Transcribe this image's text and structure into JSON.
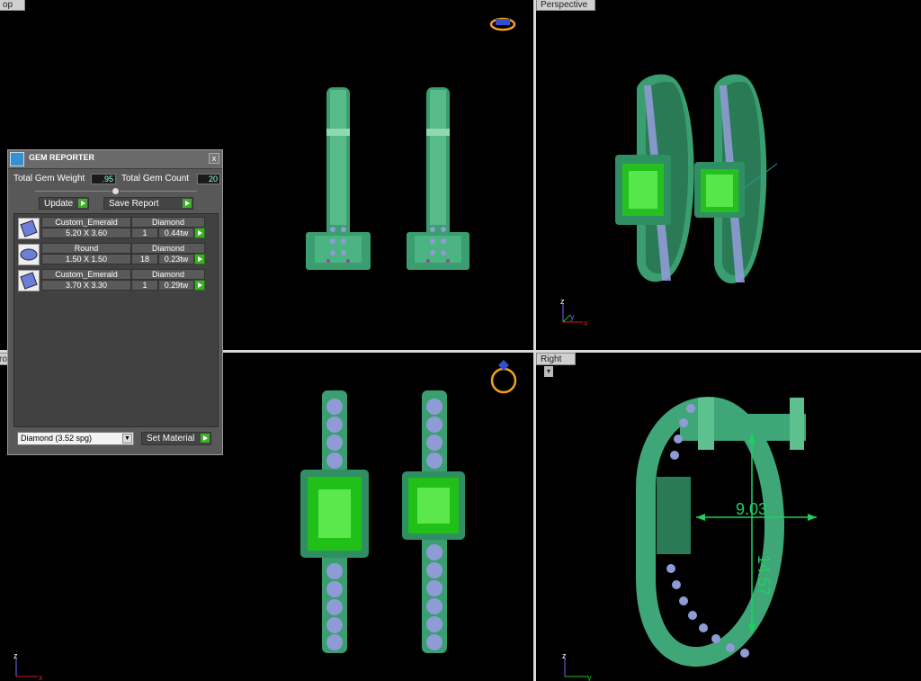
{
  "viewports": {
    "top_label": "op",
    "perspective_label": "Perspective",
    "right_label": "Right",
    "front_label": "ro"
  },
  "axes": {
    "z": "z",
    "y": "y",
    "x": "x"
  },
  "dimensions": {
    "width": "9.03",
    "height": "14.57"
  },
  "gem_reporter": {
    "title": "GEM REPORTER",
    "close": "x",
    "total_weight_label": "Total Gem Weight",
    "total_weight_value": ".95",
    "total_count_label": "Total Gem Count",
    "total_count_value": "20",
    "update_button": "Update",
    "save_report_button": "Save Report",
    "gems": [
      {
        "shape": "Custom_Emerald",
        "material": "Diamond",
        "size": "5.20 X 3.60",
        "count": "1",
        "weight": "0.44tw"
      },
      {
        "shape": "Round",
        "material": "Diamond",
        "size": "1.50 X 1.50",
        "count": "18",
        "weight": "0.23tw"
      },
      {
        "shape": "Custom_Emerald",
        "material": "Diamond",
        "size": "3.70 X 3.30",
        "count": "1",
        "weight": "0.29tw"
      }
    ],
    "material_select": "Diamond     (3.52 spg)",
    "set_material_button": "Set Material"
  },
  "colors": {
    "metal": "#3fa677",
    "metal_light": "#5cc08f",
    "metal_dark": "#2a7a55",
    "emerald": "#2ad020",
    "emerald_light": "#7dff6a",
    "diamond": "#8f9bd4",
    "prong": "#a040a0",
    "dimension": "#1fd060"
  }
}
